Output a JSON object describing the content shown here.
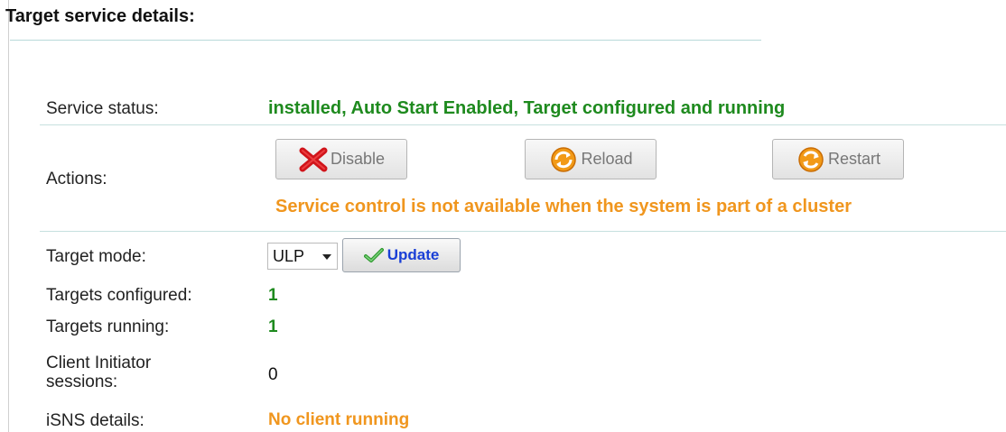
{
  "section_title": "Target service details:",
  "rows": {
    "service_status": {
      "label": "Service status:",
      "value": "installed, Auto Start Enabled, Target configured and running"
    },
    "actions": {
      "label": "Actions:",
      "buttons": {
        "disable": "Disable",
        "reload": "Reload",
        "restart": "Restart"
      },
      "warning": "Service control is not available when the system is part of a cluster"
    },
    "target_mode": {
      "label": "Target mode:",
      "selected": "ULP",
      "update_label": "Update"
    },
    "targets_configured": {
      "label": "Targets configured:",
      "value": "1"
    },
    "targets_running": {
      "label": "Targets running:",
      "value": "1"
    },
    "client_initiator_sessions": {
      "label_line1": "Client Initiator",
      "label_line2": "sessions:",
      "value": "0"
    },
    "isns_details": {
      "label": "iSNS details:",
      "value": "No client running"
    }
  },
  "colors": {
    "status_green": "#1e8a1e",
    "warning_orange": "#f0961e",
    "link_blue": "#1a3fd6",
    "rule_teal": "#c6e0df"
  },
  "icons": {
    "disable": "red-x-icon",
    "reload": "reload-icon",
    "restart": "restart-icon",
    "update": "checkmark-icon",
    "select": "chevron-down-icon"
  }
}
